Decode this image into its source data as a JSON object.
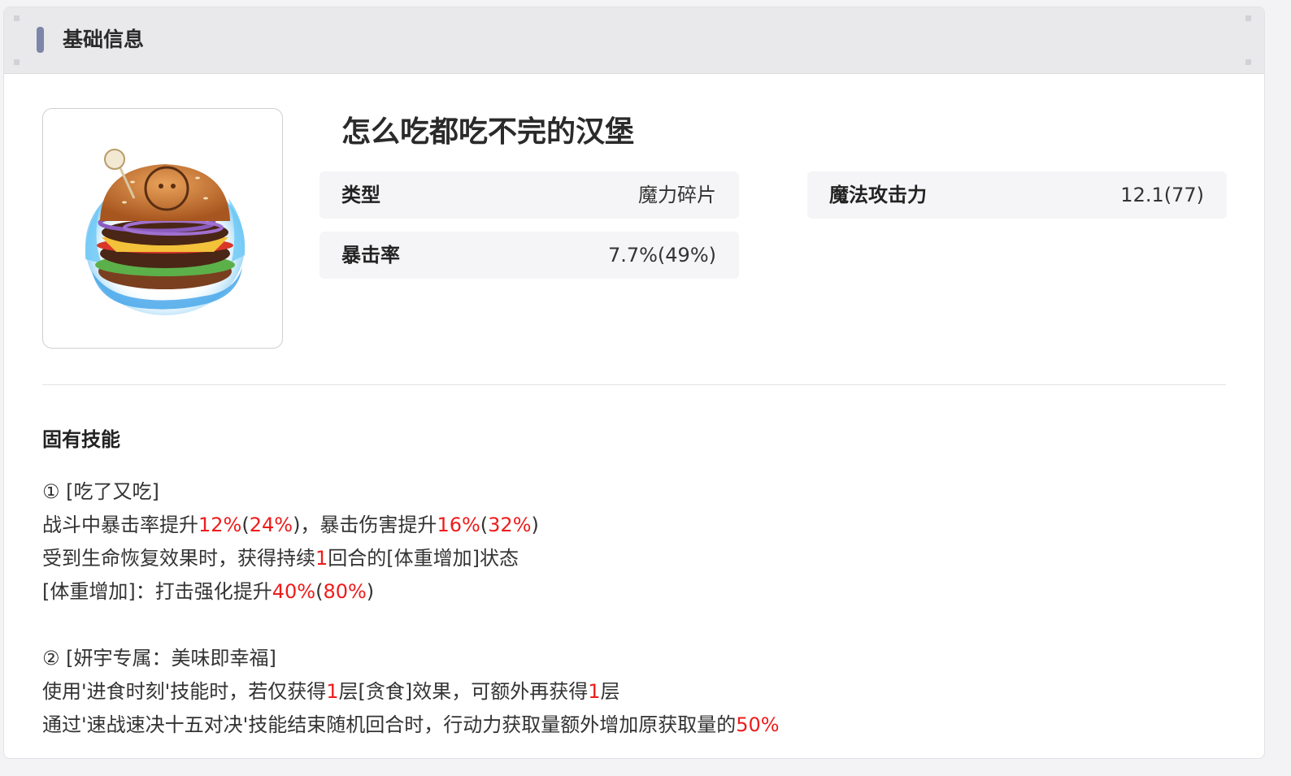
{
  "header": {
    "title": "基础信息"
  },
  "item": {
    "name": "怎么吃都吃不完的汉堡",
    "image": "hamburger-item-icon"
  },
  "stats": [
    {
      "label": "类型",
      "value": "魔力碎片"
    },
    {
      "label": "魔法攻击力",
      "value": "12.1(77)"
    },
    {
      "label": "暴击率",
      "value": "7.7%(49%)"
    }
  ],
  "skills": {
    "title": "固有技能",
    "lines": [
      {
        "a": "① [吃了又吃]"
      },
      {
        "a": "战斗中暴击率提升",
        "b": "12%",
        "c": "(",
        "d": "24%",
        "e": ")，暴击伤害提升",
        "f": "16%",
        "g": "(",
        "h": "32%",
        "i": ")"
      },
      {
        "a": "受到生命恢复效果时，获得持续",
        "b": "1",
        "c": "回合的[体重增加]状态"
      },
      {
        "a": "[体重增加]：打击强化提升",
        "b": "40%",
        "c": "(",
        "d": "80%",
        "e": ")"
      },
      {
        "a": ""
      },
      {
        "a": "② [妍宇专属：美味即幸福]"
      },
      {
        "a": "使用'进食时刻'技能时，若仅获得",
        "b": "1",
        "c": "层[贪食]效果，可额外再获得",
        "d": "1",
        "e": "层"
      },
      {
        "a": "通过'速战速决十五对决'技能结束随机回合时，行动力获取量额外增加原获取量的",
        "b": "50%"
      }
    ]
  },
  "colors": {
    "highlight": "#ee1c1c",
    "accent_bar": "#7b86a8"
  }
}
